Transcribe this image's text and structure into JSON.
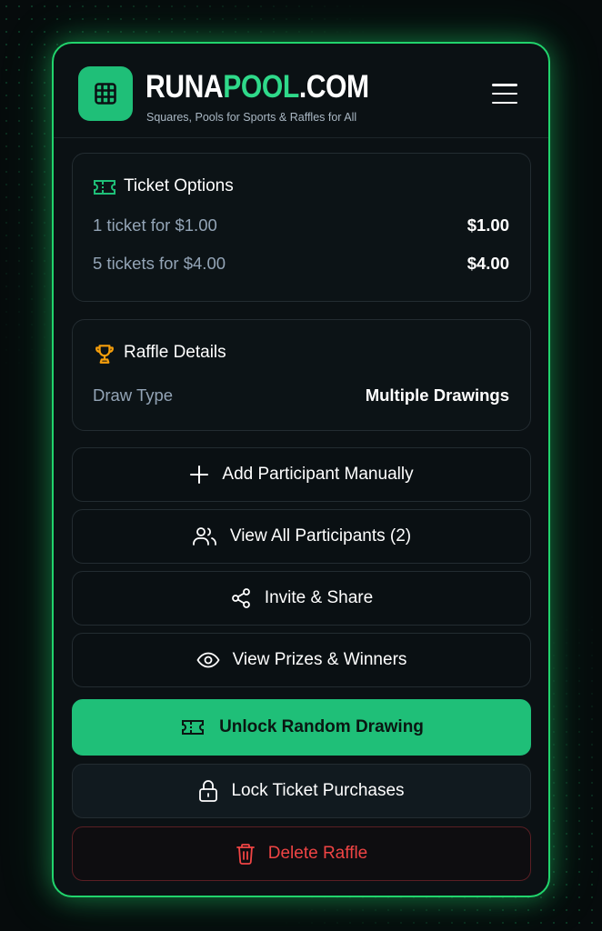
{
  "brand": {
    "name_part1": "RUNA",
    "name_part2": "POOL",
    "name_part3": ".COM",
    "tagline": "Squares, Pools for Sports & Raffles for All",
    "logo_icon": "grid-icon"
  },
  "ticket_options": {
    "title": "Ticket Options",
    "icon": "ticket-icon",
    "rows": [
      {
        "label": "1 ticket for $1.00",
        "value": "$1.00"
      },
      {
        "label": "5 tickets for $4.00",
        "value": "$4.00"
      }
    ]
  },
  "raffle_details": {
    "title": "Raffle Details",
    "icon": "trophy-icon",
    "rows": [
      {
        "label": "Draw Type",
        "value": "Multiple Drawings"
      }
    ]
  },
  "actions": {
    "add_participant": "Add Participant Manually",
    "view_participants": "View All Participants (2)",
    "invite_share": "Invite & Share",
    "view_prizes": "View Prizes & Winners",
    "unlock_drawing": "Unlock Random Drawing",
    "lock_purchases": "Lock Ticket Purchases",
    "delete_raffle": "Delete Raffle"
  },
  "colors": {
    "accent": "#1fbf78",
    "glow": "#21d46c",
    "danger": "#ef4444",
    "trophy": "#f59e0b",
    "background": "#060b0c"
  }
}
